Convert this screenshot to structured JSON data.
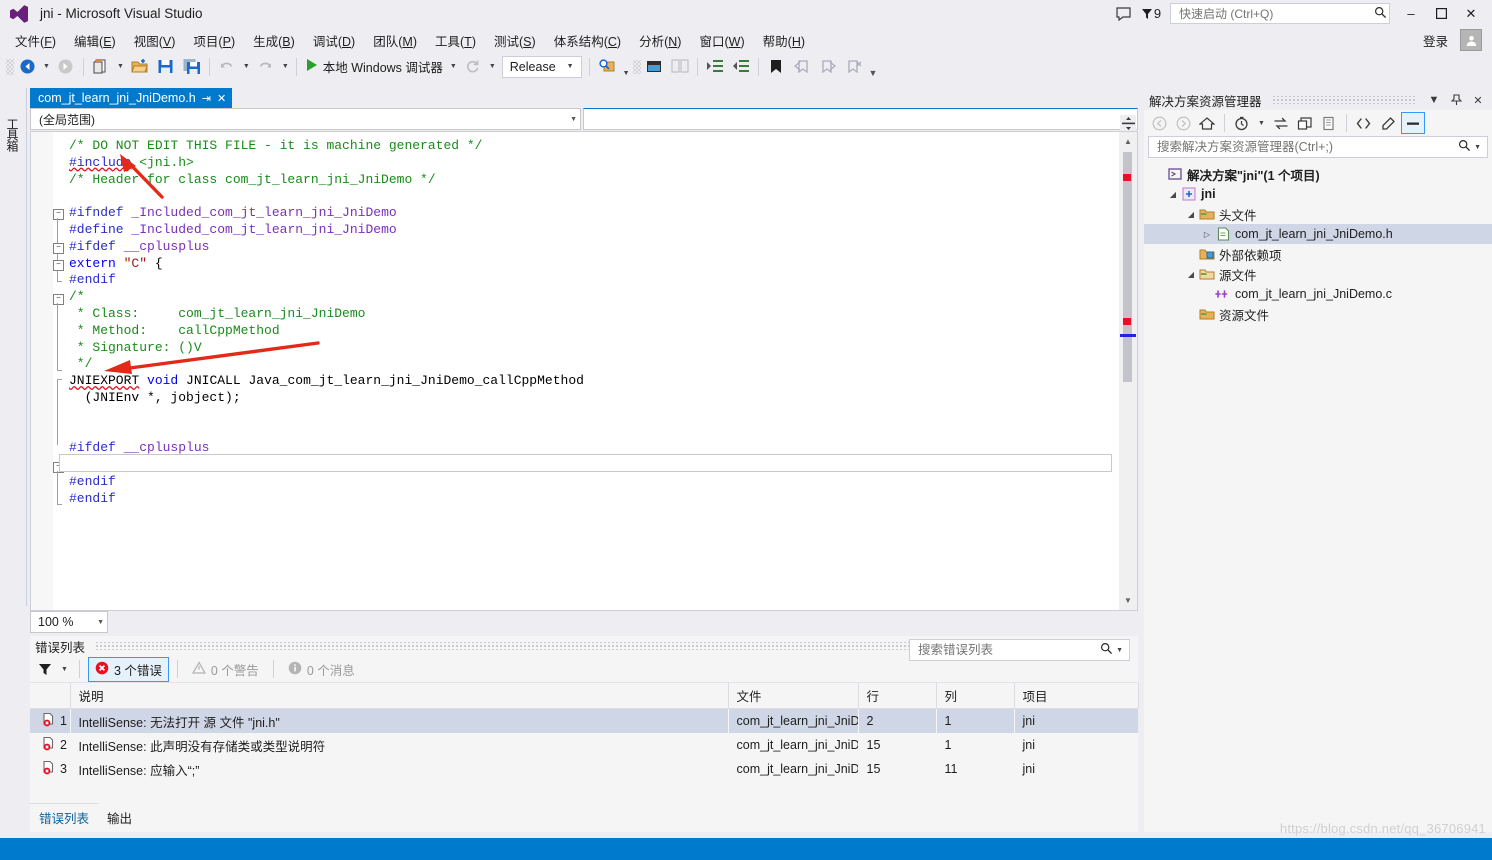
{
  "window": {
    "title": "jni - Microsoft Visual Studio",
    "logo_icon": "visual-studio-logo",
    "minimize_label": "–",
    "maximize_label": "❐",
    "close_label": "✕"
  },
  "titlebar": {
    "feedback_icon": "feedback-icon",
    "notification_icon": "notification-flag-icon",
    "notification_count": "9",
    "quick_launch_placeholder": "快速启动 (Ctrl+Q)",
    "quick_launch_value": "",
    "search_icon": "search-icon"
  },
  "menu": {
    "items": [
      {
        "label": "文件",
        "key": "F"
      },
      {
        "label": "编辑",
        "key": "E"
      },
      {
        "label": "视图",
        "key": "V"
      },
      {
        "label": "项目",
        "key": "P"
      },
      {
        "label": "生成",
        "key": "B"
      },
      {
        "label": "调试",
        "key": "D"
      },
      {
        "label": "团队",
        "key": "M"
      },
      {
        "label": "工具",
        "key": "T"
      },
      {
        "label": "测试",
        "key": "S"
      },
      {
        "label": "体系结构",
        "key": "C"
      },
      {
        "label": "分析",
        "key": "N"
      },
      {
        "label": "窗口",
        "key": "W"
      },
      {
        "label": "帮助",
        "key": "H"
      }
    ],
    "signin_label": "登录",
    "account_icon": "account-icon"
  },
  "toolbar": {
    "nav_back_icon": "navigate-back-icon",
    "nav_forward_icon": "navigate-forward-icon",
    "new_item_icon": "new-item-icon",
    "open_file_icon": "open-file-icon",
    "save_icon": "save-icon",
    "save_all_icon": "save-all-icon",
    "undo_icon": "undo-icon",
    "redo_icon": "redo-icon",
    "run_icon": "start-debug-play-icon",
    "run_label": "本地 Windows 调试器",
    "refresh_icon": "refresh-icon",
    "config_value": "Release",
    "find_icon": "find-in-files-icon",
    "window_icon": "new-window-icon",
    "compare_icon": "compare-files-icon",
    "indent_icon": "increase-indent-icon",
    "outdent_icon": "decrease-indent-icon",
    "bookmark_icon": "bookmark-icon",
    "bookmark_prev_icon": "previous-bookmark-icon",
    "bookmark_next_icon": "next-bookmark-icon",
    "bookmark_clear_icon": "clear-bookmark-icon",
    "overflow_icon": "toolbar-overflow-icon"
  },
  "left_dock": {
    "toolbox_label": "工具箱"
  },
  "editor": {
    "tab_label": "com_jt_learn_jni_JniDemo.h",
    "tab_pin_icon": "pin-icon",
    "tab_close_icon": "close-icon",
    "scope_combo_value": "(全局范围)",
    "member_combo_value": "",
    "zoom_value": "100 %",
    "code_lines": [
      "/* DO NOT EDIT THIS FILE - it is machine generated */",
      "#include <jni.h>",
      "/* Header for class com_jt_learn_jni_JniDemo */",
      "",
      "#ifndef _Included_com_jt_learn_jni_JniDemo",
      "#define _Included_com_jt_learn_jni_JniDemo",
      "#ifdef __cplusplus",
      "extern \"C\" {",
      "#endif",
      "/*",
      " * Class:     com_jt_learn_jni_JniDemo",
      " * Method:    callCppMethod",
      " * Signature: ()V",
      " */",
      "JNIEXPORT void JNICALL Java_com_jt_learn_jni_JniDemo_callCppMethod",
      "  (JNIEnv *, jobject);",
      "",
      "#ifdef __cplusplus",
      "}",
      "#endif",
      "#endif"
    ]
  },
  "solution_explorer": {
    "title": "解决方案资源管理器",
    "dropdown_icon": "chevron-down-icon",
    "pin_icon": "pin-icon",
    "close_icon": "close-icon",
    "toolbar_icons": [
      "back-icon",
      "forward-icon",
      "home-icon",
      "pending-changes-icon",
      "sync-with-active-document-icon",
      "refresh-icon",
      "collapse-all-icon",
      "show-all-files-icon",
      "properties-icon",
      "preview-selected-items-icon"
    ],
    "search_placeholder": "搜索解决方案资源管理器(Ctrl+;)",
    "search_value": "",
    "search_icon": "search-icon",
    "tree": [
      {
        "label": "解决方案\"jni\"(1 个项目)",
        "icon": "solution-icon",
        "indent": 0,
        "twisty": "",
        "bold": true,
        "selected": false
      },
      {
        "label": "jni",
        "icon": "cpp-project-icon",
        "indent": 1,
        "twisty": "◢",
        "bold": true,
        "selected": false
      },
      {
        "label": "头文件",
        "icon": "folder-filter-icon",
        "indent": 2,
        "twisty": "◢",
        "bold": false,
        "selected": false
      },
      {
        "label": "com_jt_learn_jni_JniDemo.h",
        "icon": "header-file-icon",
        "indent": 3,
        "twisty": "▷",
        "bold": false,
        "selected": true
      },
      {
        "label": "外部依赖项",
        "icon": "folder-external-icon",
        "indent": 2,
        "twisty": "",
        "bold": false,
        "selected": false
      },
      {
        "label": "源文件",
        "icon": "folder-filter-icon",
        "indent": 2,
        "twisty": "◢",
        "bold": false,
        "selected": false
      },
      {
        "label": "com_jt_learn_jni_JniDemo.c",
        "icon": "c-file-icon",
        "indent": 3,
        "twisty": "",
        "bold": false,
        "selected": false
      },
      {
        "label": "资源文件",
        "icon": "folder-filter-icon",
        "indent": 2,
        "twisty": "",
        "bold": false,
        "selected": false
      }
    ]
  },
  "error_list": {
    "title": "错误列表",
    "dropdown_icon": "chevron-down-icon",
    "pin_icon": "pin-icon",
    "close_icon": "close-icon",
    "filter_icon": "filter-icon",
    "errors_label": "3 个错误",
    "warnings_label": "0 个警告",
    "messages_label": "0 个消息",
    "error_icon": "error-circle-icon",
    "warning_icon": "warning-triangle-icon",
    "info_icon": "info-circle-icon",
    "search_placeholder": "搜索错误列表",
    "search_value": "",
    "search_icon": "search-icon",
    "columns": [
      "说明",
      "文件",
      "行",
      "列",
      "项目"
    ],
    "rows": [
      {
        "num": "1",
        "description": "IntelliSense: 无法打开 源 文件 \"jni.h\"",
        "file": "com_jt_learn_jni_JniD",
        "line": "2",
        "col": "1",
        "project": "jni",
        "selected": true
      },
      {
        "num": "2",
        "description": "IntelliSense: 此声明没有存储类或类型说明符",
        "file": "com_jt_learn_jni_JniD",
        "line": "15",
        "col": "1",
        "project": "jni",
        "selected": false
      },
      {
        "num": "3",
        "description": "IntelliSense: 应输入“;”",
        "file": "com_jt_learn_jni_JniD",
        "line": "15",
        "col": "11",
        "project": "jni",
        "selected": false
      }
    ],
    "tabs": [
      {
        "label": "错误列表",
        "active": true
      },
      {
        "label": "输出",
        "active": false
      }
    ]
  },
  "watermark": {
    "text": "https://blog.csdn.net/qq_36706941"
  },
  "colors": {
    "accent": "#007acc",
    "error_red": "#e81123",
    "selection": "#cfd6e5",
    "comment_green": "#1a8b1a",
    "preproc_blue": "#2b2bcd",
    "macro_purple": "#7b2fbe",
    "string_red": "#a31515",
    "annotation_arrow": "#e32a19"
  }
}
